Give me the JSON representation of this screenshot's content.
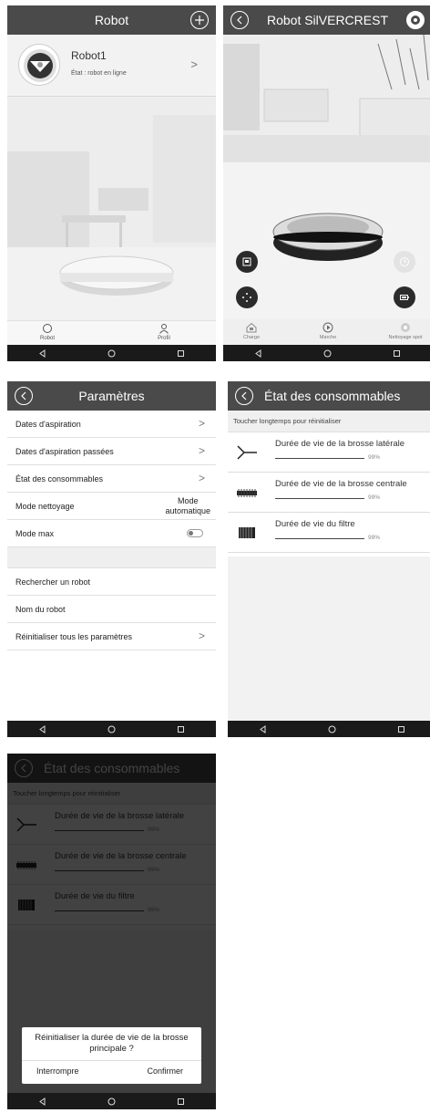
{
  "screen1": {
    "title": "Robot",
    "robot_name": "Robot1",
    "robot_state": "État : robot en ligne",
    "tabs": [
      "Robot",
      "Profil"
    ]
  },
  "screen2": {
    "title": "Robot SilVERCREST",
    "actions": [
      "Charge",
      "Marche",
      "Nettoyage spot"
    ]
  },
  "screen3": {
    "title": "Paramètres",
    "rows": [
      "Dates d'aspiration",
      "Dates d'aspiration passées",
      "État des consommables",
      "Mode nettoyage",
      "Mode max",
      "Rechercher un robot",
      "Nom du robot",
      "Réinitialiser tous les paramètres"
    ],
    "mode_value_line1": "Mode",
    "mode_value_line2": "automatique"
  },
  "screen4": {
    "title": "État des consommables",
    "hint": "Toucher longtemps pour réinitialiser",
    "items": [
      {
        "label": "Durée de vie de la brosse latérale",
        "percent": "99%"
      },
      {
        "label": "Durée de vie de la brosse centrale",
        "percent": "99%"
      },
      {
        "label": "Durée de vie du filtre",
        "percent": "99%"
      }
    ]
  },
  "screen5": {
    "dialog_message": "Réinitialiser la durée de vie de la brosse principale ?",
    "cancel_label": "Interrompre",
    "confirm_label": "Confirmer"
  },
  "colors": {
    "appbar": "#4a4a4a",
    "navbar": "#1a1a1a"
  }
}
